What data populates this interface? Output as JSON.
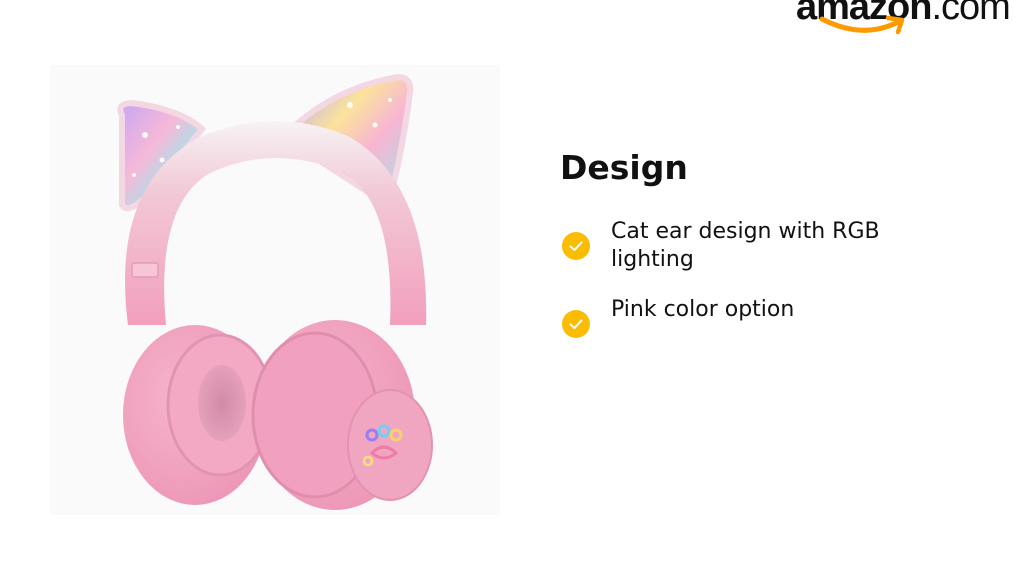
{
  "brand": {
    "logo_text_bold": "amazon",
    "logo_text_light": ".com",
    "logo_icon": "amazon-smile-logo",
    "accent_color": "#ff9900"
  },
  "product_image": {
    "icon": "pink-cat-ear-headphones-image",
    "colors": {
      "pink": "#f2a3bf",
      "ear_cushion": "#eea0bd",
      "rgb_ear_light": "#a8e8ea"
    }
  },
  "section": {
    "title": "Design",
    "check_icon": "checkmark-circle-icon",
    "check_color": "#fbbc04",
    "features": [
      {
        "text": "Cat ear design with RGB lighting"
      },
      {
        "text": "Pink color option"
      }
    ]
  }
}
